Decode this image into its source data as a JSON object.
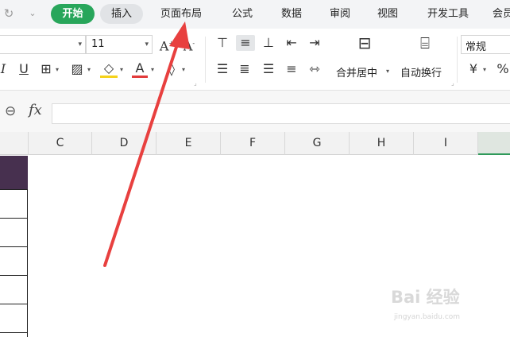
{
  "menu": {
    "tabs": [
      {
        "label": "开始"
      },
      {
        "label": "插入"
      },
      {
        "label": "页面布局"
      },
      {
        "label": "公式"
      },
      {
        "label": "数据"
      },
      {
        "label": "审阅"
      },
      {
        "label": "视图"
      },
      {
        "label": "开发工具"
      },
      {
        "label": "会员"
      }
    ],
    "active_tab": "开始",
    "active_color": "#28a65b"
  },
  "ribbon": {
    "font_size_value": "11",
    "merge_center_label": "合并居中",
    "wrap_text_label": "自动换行",
    "number_format_value": "常规",
    "currency_symbol": "¥",
    "percent_symbol": "%"
  },
  "formula_bar": {
    "fx_label": "fx",
    "value": ""
  },
  "columns": [
    {
      "label": "C"
    },
    {
      "label": "D"
    },
    {
      "label": "E"
    },
    {
      "label": "F"
    },
    {
      "label": "G"
    },
    {
      "label": "H"
    },
    {
      "label": "I"
    },
    {
      "label": ""
    }
  ],
  "annotation": {
    "arrow_color": "#e8403f",
    "target": "页面布局"
  },
  "watermark": {
    "logo": "Bai 经验",
    "url": "jingyan.baidu.com"
  }
}
